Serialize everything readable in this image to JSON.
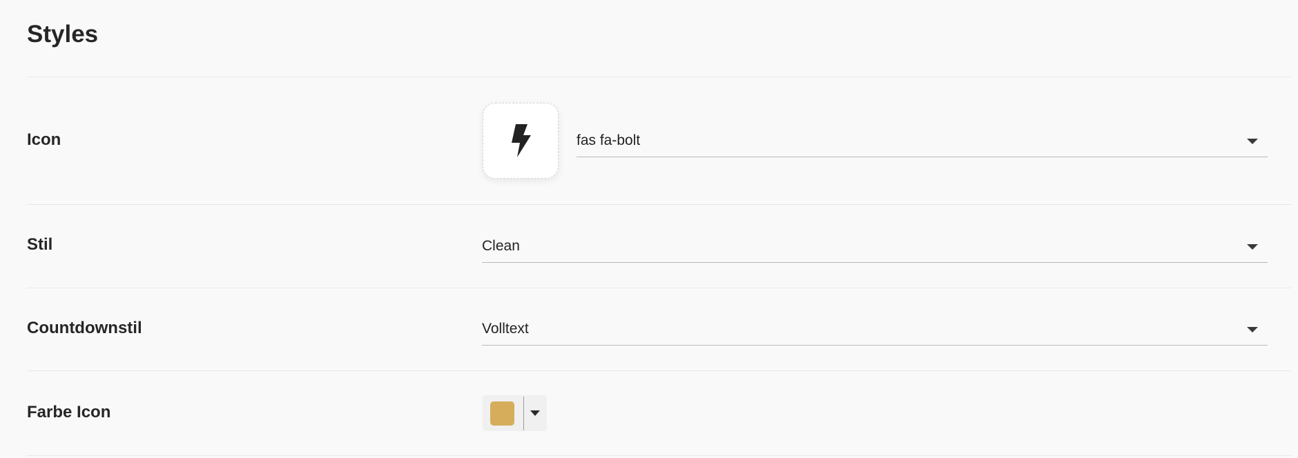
{
  "page": {
    "title": "Styles"
  },
  "rows": {
    "icon": {
      "label": "Icon",
      "value": "fas fa-bolt",
      "preview_icon": "bolt-icon"
    },
    "stil": {
      "label": "Stil",
      "value": "Clean"
    },
    "countdown": {
      "label": "Countdownstil",
      "value": "Volltext"
    },
    "farbe": {
      "label": "Farbe Icon",
      "color": "#d5ad5b"
    }
  },
  "colors": {
    "background": "#f9f9f9",
    "divider": "#e8e8e8",
    "text": "#262626"
  }
}
